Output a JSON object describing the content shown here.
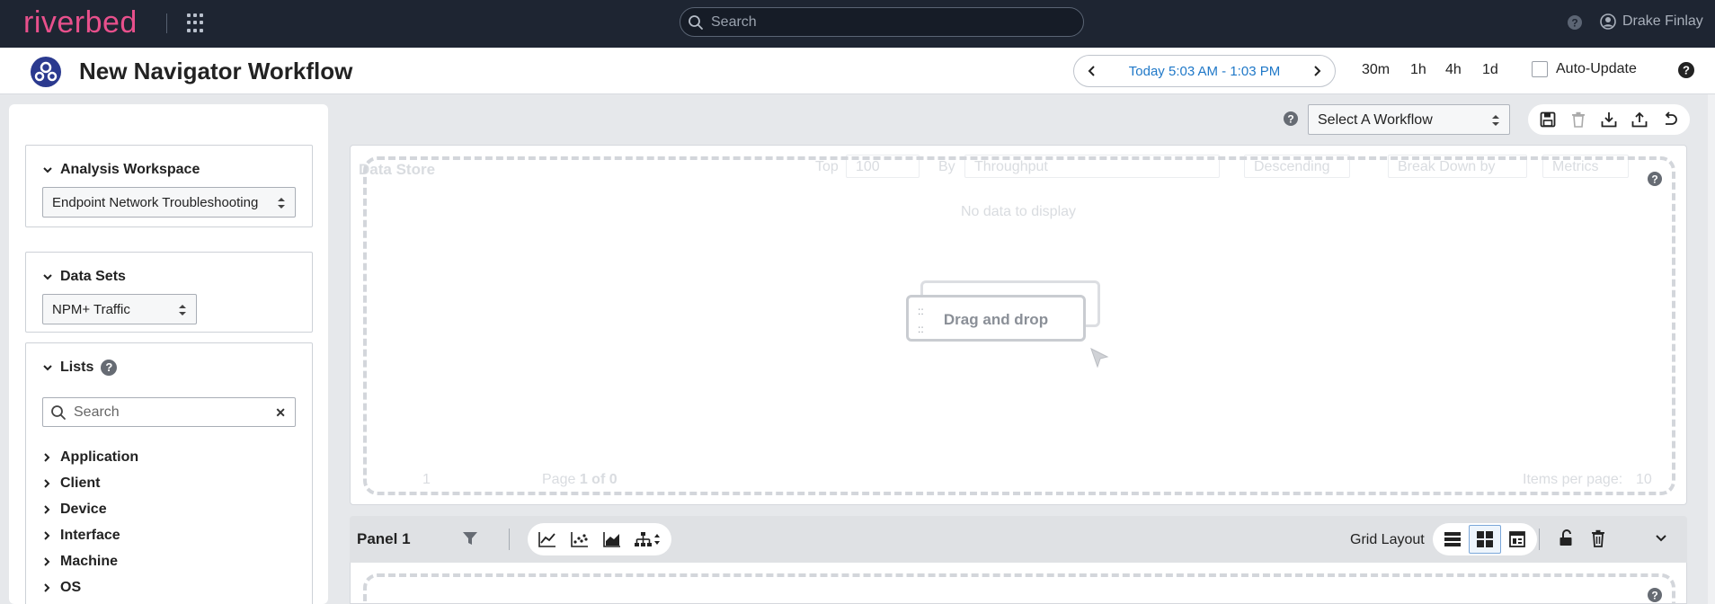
{
  "topbar": {
    "logo": "riverbed",
    "search_placeholder": "Search",
    "user_name": "Drake Finlay"
  },
  "titlebar": {
    "title": "New Navigator Workflow",
    "time_range": "Today 5:03 AM - 1:03 PM",
    "quick_ranges": [
      "30m",
      "1h",
      "4h",
      "1d"
    ],
    "auto_update_label": "Auto-Update"
  },
  "sidebar": {
    "analysis_workspace": {
      "heading": "Analysis Workspace",
      "selected": "Endpoint Network Troubleshooting"
    },
    "data_sets": {
      "heading": "Data Sets",
      "selected": "NPM+ Traffic"
    },
    "lists": {
      "heading": "Lists",
      "search_placeholder": "Search",
      "items": [
        "Application",
        "Client",
        "Device",
        "Interface",
        "Machine",
        "OS"
      ]
    }
  },
  "toolbar": {
    "workflow_select": "Select A Workflow"
  },
  "panel_main": {
    "ghost_title": "Data Store",
    "ghost_top_label": "Top",
    "ghost_top_value": "100",
    "ghost_by_label": "By",
    "ghost_by_value": "Throughput",
    "ghost_order": "Descending",
    "ghost_breakdown": "Break Down by",
    "ghost_metrics": "Metrics",
    "ghost_no_data": "No data to display",
    "ghost_page_input": "1",
    "ghost_page_label": "Page",
    "ghost_page_count": "1 of 0",
    "ghost_items_per_page": "Items per page:",
    "ghost_items_value": "10",
    "drag_label": "Drag and drop"
  },
  "panel1": {
    "name": "Panel 1",
    "grid_layout_label": "Grid Layout"
  }
}
